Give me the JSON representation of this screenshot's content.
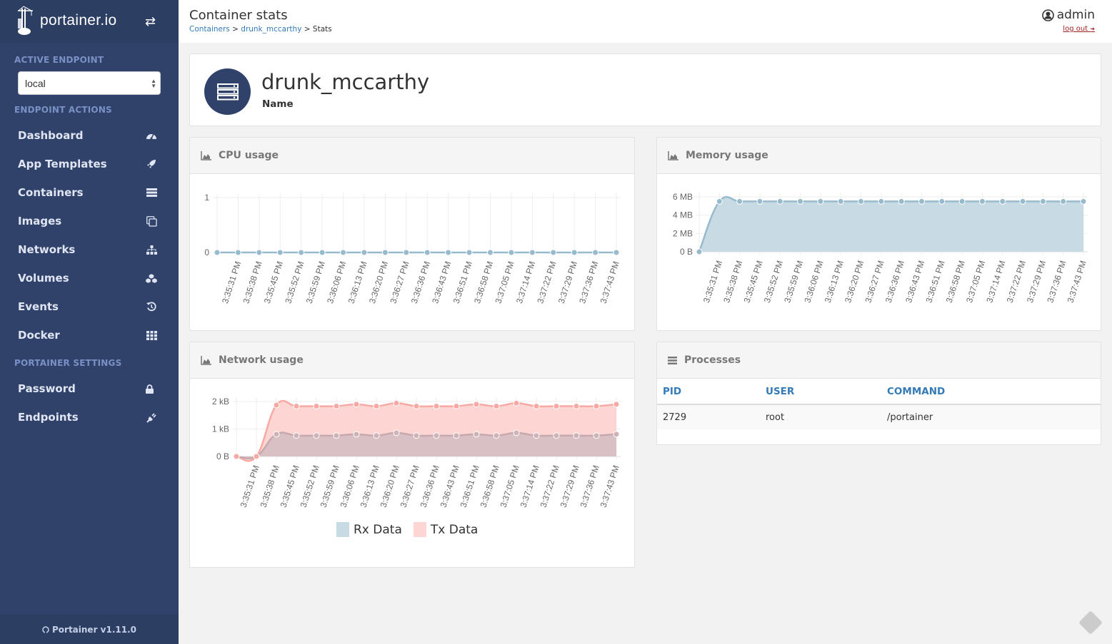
{
  "sidebar": {
    "brand": "portainer.io",
    "toggle_icon": "exchange-icon",
    "active_endpoint_title": "ACTIVE ENDPOINT",
    "endpoint_selected": "local",
    "endpoint_actions_title": "ENDPOINT ACTIONS",
    "items": [
      {
        "label": "Dashboard",
        "icon": "tachometer-icon"
      },
      {
        "label": "App Templates",
        "icon": "rocket-icon"
      },
      {
        "label": "Containers",
        "icon": "server-icon"
      },
      {
        "label": "Images",
        "icon": "clone-icon"
      },
      {
        "label": "Networks",
        "icon": "sitemap-icon"
      },
      {
        "label": "Volumes",
        "icon": "cubes-icon"
      },
      {
        "label": "Events",
        "icon": "history-icon"
      },
      {
        "label": "Docker",
        "icon": "th-icon"
      }
    ],
    "portainer_settings_title": "PORTAINER SETTINGS",
    "settings_items": [
      {
        "label": "Password",
        "icon": "lock-icon"
      },
      {
        "label": "Endpoints",
        "icon": "plug-icon"
      }
    ],
    "footer": "Portainer v1.11.0"
  },
  "header": {
    "title": "Container stats",
    "breadcrumb": [
      "Containers",
      "drunk_mccarthy",
      "Stats"
    ],
    "breadcrumb_sep": ">",
    "user": "admin",
    "logout": "log out"
  },
  "container": {
    "name": "drunk_mccarthy",
    "name_label": "Name"
  },
  "panels": {
    "cpu_title": "CPU usage",
    "memory_title": "Memory usage",
    "network_title": "Network usage",
    "processes_title": "Processes"
  },
  "processes": {
    "columns": [
      "PID",
      "USER",
      "COMMAND"
    ],
    "rows": [
      [
        "2729",
        "root",
        "/portainer"
      ]
    ]
  },
  "colors": {
    "sidebar": "#30426a",
    "link": "#337ab7",
    "rx_line": "#97bbcd",
    "rx_fill": "#c8dbe4",
    "tx_line": "#f7a9a3",
    "tx_fill": "#fdd6d3",
    "logout": "#a42222"
  },
  "chart_data": [
    {
      "type": "line",
      "title": "CPU usage",
      "ylim": [
        0,
        1
      ],
      "yticks": [
        "0",
        "1"
      ],
      "x": [
        "",
        "3:35:31 PM",
        "3:35:38 PM",
        "3:35:45 PM",
        "3:35:52 PM",
        "3:35:59 PM",
        "3:36:06 PM",
        "3:36:13 PM",
        "3:36:20 PM",
        "3:36:27 PM",
        "3:36:36 PM",
        "3:36:43 PM",
        "3:36:51 PM",
        "3:36:58 PM",
        "3:37:05 PM",
        "3:37:14 PM",
        "3:37:22 PM",
        "3:37:29 PM",
        "3:37:36 PM",
        "3:37:43 PM"
      ],
      "series": [
        {
          "name": "CPU",
          "values": [
            0,
            0,
            0,
            0,
            0,
            0,
            0,
            0,
            0,
            0,
            0,
            0,
            0,
            0,
            0,
            0,
            0,
            0,
            0,
            0
          ]
        }
      ],
      "grid": true
    },
    {
      "type": "area",
      "title": "Memory usage",
      "ylim": [
        0,
        6
      ],
      "yunit": "MB",
      "yticks": [
        "0 B",
        "2 MB",
        "4 MB",
        "6 MB"
      ],
      "x": [
        "",
        "3:35:31 PM",
        "3:35:38 PM",
        "3:35:45 PM",
        "3:35:52 PM",
        "3:35:59 PM",
        "3:36:06 PM",
        "3:36:13 PM",
        "3:36:20 PM",
        "3:36:27 PM",
        "3:36:36 PM",
        "3:36:43 PM",
        "3:36:51 PM",
        "3:36:58 PM",
        "3:37:05 PM",
        "3:37:14 PM",
        "3:37:22 PM",
        "3:37:29 PM",
        "3:37:36 PM",
        "3:37:43 PM"
      ],
      "series": [
        {
          "name": "Memory",
          "values": [
            0,
            5.5,
            5.5,
            5.5,
            5.5,
            5.5,
            5.5,
            5.5,
            5.5,
            5.5,
            5.5,
            5.5,
            5.5,
            5.5,
            5.5,
            5.5,
            5.5,
            5.5,
            5.5,
            5.5
          ]
        }
      ],
      "grid": true
    },
    {
      "type": "area",
      "title": "Network usage",
      "ylim": [
        0,
        2
      ],
      "yunit": "kB",
      "yticks": [
        "0 B",
        "1 kB",
        "2 kB"
      ],
      "x": [
        "",
        "3:35:31 PM",
        "3:35:38 PM",
        "3:35:45 PM",
        "3:35:52 PM",
        "3:35:59 PM",
        "3:36:06 PM",
        "3:36:13 PM",
        "3:36:20 PM",
        "3:36:27 PM",
        "3:36:36 PM",
        "3:36:43 PM",
        "3:36:51 PM",
        "3:36:58 PM",
        "3:37:05 PM",
        "3:37:14 PM",
        "3:37:22 PM",
        "3:37:29 PM",
        "3:37:36 PM",
        "3:37:43 PM"
      ],
      "series": [
        {
          "name": "Rx Data",
          "values": [
            0,
            0,
            0.81,
            0.76,
            0.76,
            0.76,
            0.81,
            0.76,
            0.86,
            0.76,
            0.76,
            0.76,
            0.81,
            0.76,
            0.86,
            0.76,
            0.76,
            0.76,
            0.76,
            0.81
          ]
        },
        {
          "name": "Tx Data",
          "values": [
            0,
            0,
            1.87,
            1.83,
            1.83,
            1.83,
            1.9,
            1.83,
            1.94,
            1.83,
            1.83,
            1.83,
            1.9,
            1.83,
            1.94,
            1.83,
            1.83,
            1.83,
            1.83,
            1.9
          ]
        }
      ],
      "legend": "bottom",
      "grid": true
    }
  ]
}
